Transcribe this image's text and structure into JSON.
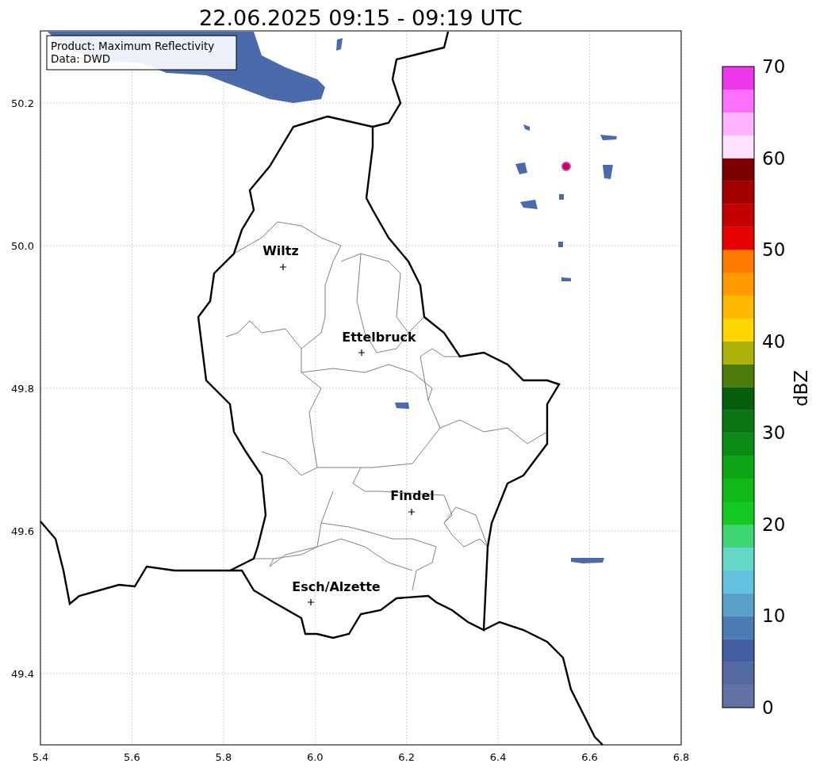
{
  "title": "22.06.2025 09:15 - 09:19 UTC",
  "info_box": [
    "Product: Maximum Reflectivity",
    "Data: DWD"
  ],
  "cities": [
    {
      "name": "Wiltz"
    },
    {
      "name": "Ettelbruck"
    },
    {
      "name": "Findel"
    },
    {
      "name": "Esch/Alzette"
    }
  ],
  "x_ticks": [
    "5.4",
    "5.6",
    "5.8",
    "6.0",
    "6.2",
    "6.4",
    "6.6",
    "6.8"
  ],
  "y_ticks": [
    "50.2",
    "50.0",
    "49.8",
    "49.6",
    "49.4"
  ],
  "colorbar": {
    "label": "dBZ",
    "ticks": [
      "70",
      "60",
      "50",
      "40",
      "30",
      "20",
      "10",
      "0"
    ],
    "bins": [
      {
        "color": "#6272a4"
      },
      {
        "color": "#5469a0"
      },
      {
        "color": "#445fa1"
      },
      {
        "color": "#4b7bb3"
      },
      {
        "color": "#58a0c8"
      },
      {
        "color": "#63c1dd"
      },
      {
        "color": "#65d7c6"
      },
      {
        "color": "#3fd774"
      },
      {
        "color": "#15c922"
      },
      {
        "color": "#12b91b"
      },
      {
        "color": "#0ea616"
      },
      {
        "color": "#0c8c14"
      },
      {
        "color": "#0a7612"
      },
      {
        "color": "#075e0d"
      },
      {
        "color": "#4a7b0b"
      },
      {
        "color": "#aeb208"
      },
      {
        "color": "#ffd700"
      },
      {
        "color": "#ffb900"
      },
      {
        "color": "#ff9a00"
      },
      {
        "color": "#ff7b00"
      },
      {
        "color": "#e60000"
      },
      {
        "color": "#c40000"
      },
      {
        "color": "#a30000"
      },
      {
        "color": "#7d0000"
      },
      {
        "color": "#ffe0ff"
      },
      {
        "color": "#ffb3ff"
      },
      {
        "color": "#ff70ff"
      },
      {
        "color": "#ed38ed"
      }
    ]
  }
}
